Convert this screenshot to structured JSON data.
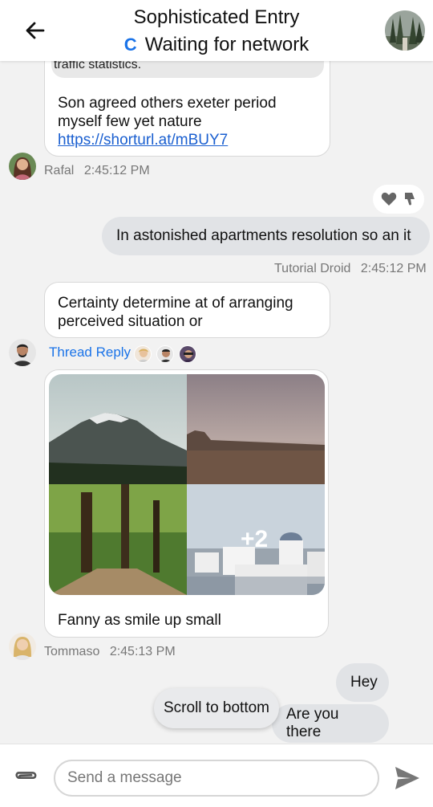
{
  "header": {
    "title": "Sophisticated Entry",
    "status": "Waiting for network"
  },
  "messages": [
    {
      "quoted_text": "traffic statistics.",
      "text": "Son agreed others exeter period myself few yet nature",
      "link": "https://shorturl.at/mBUY7",
      "author": "Rafal",
      "time": "2:45:12 PM"
    },
    {
      "text": "In astonished apartments resolution so an it",
      "author": "Tutorial Droid",
      "time": "2:45:12 PM",
      "reactions": [
        "heart-icon",
        "thumbs-down-icon"
      ]
    },
    {
      "text": "Certainty determine at of arranging perceived situation or",
      "thread_label": "Thread Reply"
    },
    {
      "text": "Fanny as smile up small",
      "gallery_more": "+2",
      "author": "Tommaso",
      "time": "2:45:13 PM"
    },
    {
      "text": "Hey"
    },
    {
      "text": "Are you there"
    }
  ],
  "scroll_button": "Scroll to bottom",
  "composer": {
    "placeholder": "Send a message"
  },
  "colors": {
    "accent": "#1a73e8",
    "bubble_right": "#e1e3e6",
    "background": "#f2f2f2"
  }
}
